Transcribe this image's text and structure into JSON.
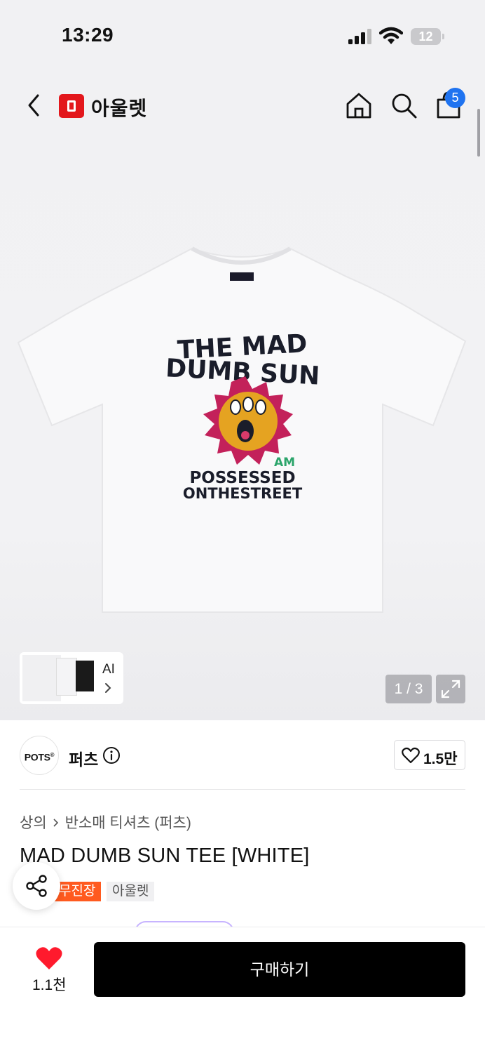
{
  "status_bar": {
    "time": "13:29",
    "battery_level": "12",
    "icons": [
      "cellular-signal-icon",
      "wifi-icon",
      "battery-icon"
    ]
  },
  "header": {
    "brand_logo_letter": "0",
    "brand_name": "아울렛",
    "cart_count": "5",
    "icons": [
      "back-arrow-icon",
      "home-icon",
      "search-icon",
      "shopping-bag-icon"
    ]
  },
  "gallery": {
    "ai_label": "AI",
    "page_indicator": "1 / 3",
    "shirt_print": {
      "line1": "THE MAD",
      "line2": "DUMB SUN",
      "small_mark": "AM",
      "line3": "POSSESSED",
      "line4": "ONTHESTREET"
    }
  },
  "brand": {
    "avatar_text": "POTS",
    "avatar_mark": "®",
    "name": "퍼츠",
    "like_count": "1.5만"
  },
  "product": {
    "breadcrumb": [
      "상의",
      "반소매 티셔츠 (퍼츠)"
    ],
    "title": "MAD DUMB SUN TEE [WHITE]",
    "tag_delivery": "무진장",
    "tag_outlet": "아울렛"
  },
  "bottom_bar": {
    "wish_count": "1.1천",
    "buy_label": "구매하기"
  },
  "colors": {
    "brand_red": "#e3171c",
    "badge_blue": "#1f73f0",
    "tag_orange": "#ff5a1f",
    "heart_red": "#ff1a2d",
    "buy_black": "#000000"
  }
}
